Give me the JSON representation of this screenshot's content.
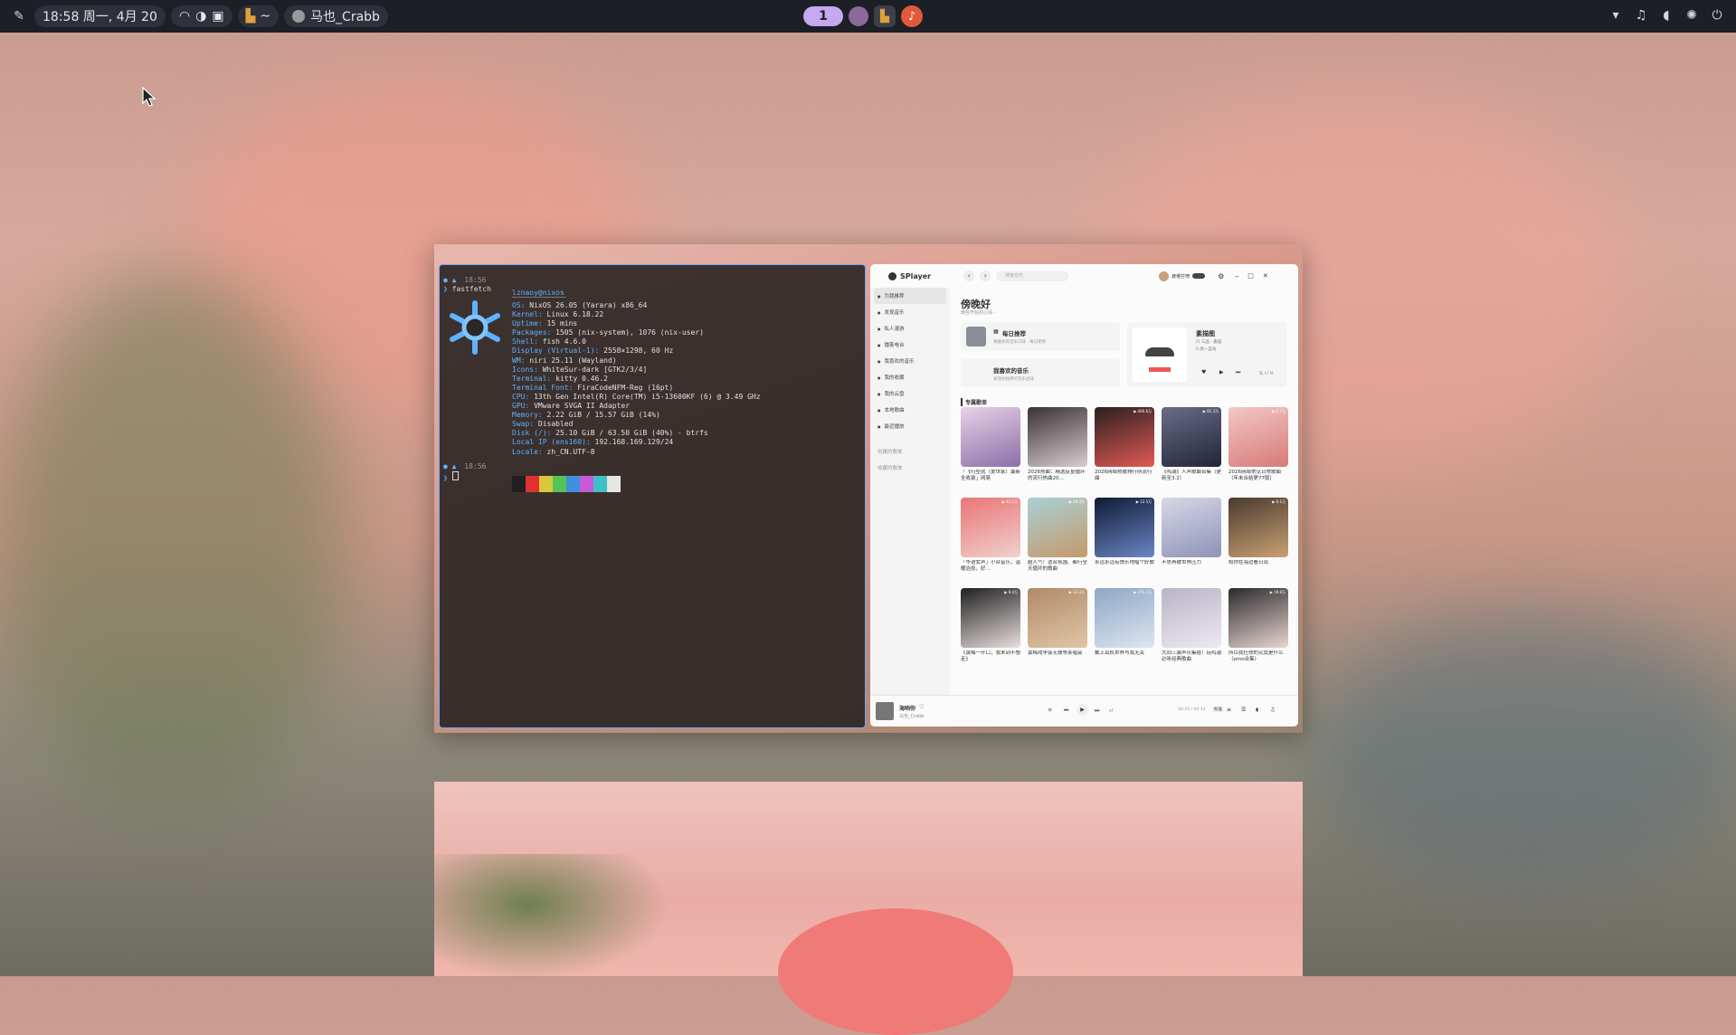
{
  "topbar": {
    "datetime": "18:58 周一, 4月 20",
    "terminal_label": "~",
    "user_label": "马也_Crabb",
    "workspace_active": "1"
  },
  "terminal": {
    "time1": "18:56",
    "command": "fastfetch",
    "user_host": "lznaoy@nixos",
    "keys": [
      "OS:",
      "Kernel:",
      "Uptime:",
      "Packages:",
      "Shell:",
      "Display (Virtual-1):",
      "WM:",
      "Icons:",
      "Terminal:",
      "Terminal Font:",
      "CPU:",
      "GPU:",
      "Memory:",
      "Swap:",
      "Disk (/):",
      "Local IP (ens160):",
      "Locale:"
    ],
    "values": [
      "NixOS 26.05 (Yarara) x86_64",
      "Linux 6.18.22",
      "15 mins",
      "1505 (nix-system), 1076 (nix-user)",
      "fish 4.6.0",
      "2558×1298, 60 Hz",
      "niri 25.11 (Wayland)",
      "WhiteSur-dark [GTK2/3/4]",
      "kitty 0.46.2",
      "FiraCodeNFM-Reg (16pt)",
      "13th Gen Intel(R) Core(TM) i5-13600KF (6) @ 3.49 GHz",
      "VMware SVGA II Adapter",
      "2.22 GiB / 15.57 GiB (14%)",
      "Disabled",
      "25.10 GiB / 63.50 GiB (40%) - btrfs",
      "192.168.169.129/24",
      "zh_CN.UTF-8"
    ],
    "time2": "18:56",
    "swatch_colors": [
      "#202020",
      "#e03030",
      "#d9c93a",
      "#54c45a",
      "#3f8fe0",
      "#c85ad6",
      "#3ec0c8",
      "#e6e6e6"
    ]
  },
  "splayer": {
    "app_name": "SPlayer",
    "search_placeholder": "搜索音乐",
    "user_name": "疲倦打喷",
    "greeting": "傍晚好",
    "greeting_sub": "晚些开始的心情 -",
    "sidebar": [
      "为我推荐",
      "发现音乐",
      "私人漫游",
      "播客电台",
      "我喜欢的音乐",
      "我的收藏",
      "我的云盘",
      "本地歌曲",
      "最近播放"
    ],
    "sidebar_bottom": [
      "创建的歌单",
      "收藏的歌单"
    ],
    "daily_title": "每日推荐",
    "daily_sub": "根据你的音乐口味 · 每日更新",
    "liked_title": "我喜欢的音乐",
    "liked_sub": "发现你独特的音乐品味",
    "fm_title": "素描图",
    "fm_sub1": "凸 三品 · 素描",
    "fm_sub2": "0 周一自动",
    "fm_note": "私人FM",
    "section_title": "专属歌单",
    "playlists": [
      {
        "title": "「飞行型就（爱世家）最新全收录」网易",
        "count": ""
      },
      {
        "title": "2026热曲：精选反复循环的流行热曲20…",
        "count": ""
      },
      {
        "title": "2026网络热歌排行所流行曲",
        "count": "400.6万"
      },
      {
        "title": "《鸣潮》人声歌曲合集（更新至3.2）",
        "count": "91.3万"
      },
      {
        "title": "2026网络常见日常歌曲（年末合结更77版）",
        "count": "1.7万"
      },
      {
        "title": "「华语女声」小众音乐，温暖治愈，好…",
        "count": "41.1万"
      },
      {
        "title": "超人气！适合氛围、都行全天循环的歌曲",
        "count": "29.4万"
      },
      {
        "title": "永远永远有快乐地唱个好歌",
        "count": "12.5万"
      },
      {
        "title": "不思再被世界压力",
        "count": ""
      },
      {
        "title": "和你在海边看日出",
        "count": "6.1万"
      },
      {
        "title": "《黄梅一开口，我未到不想走》",
        "count": "9.4万"
      },
      {
        "title": "黄梅戏学会无故等某唱会",
        "count": "13.3万"
      },
      {
        "title": "戴上耳机世界与我无关",
        "count": "371.1万"
      },
      {
        "title": "大同三装声乐集结！玩鸣潮必听经典歌曲",
        "count": ""
      },
      {
        "title": "所以我任你的究竟是什么（emo合集）",
        "count": "19.8万"
      }
    ],
    "now_playing_title": "海响你",
    "now_playing_artist": "马也_Crabb",
    "time_display": "00:41 / 04:33",
    "quality": "标准"
  }
}
